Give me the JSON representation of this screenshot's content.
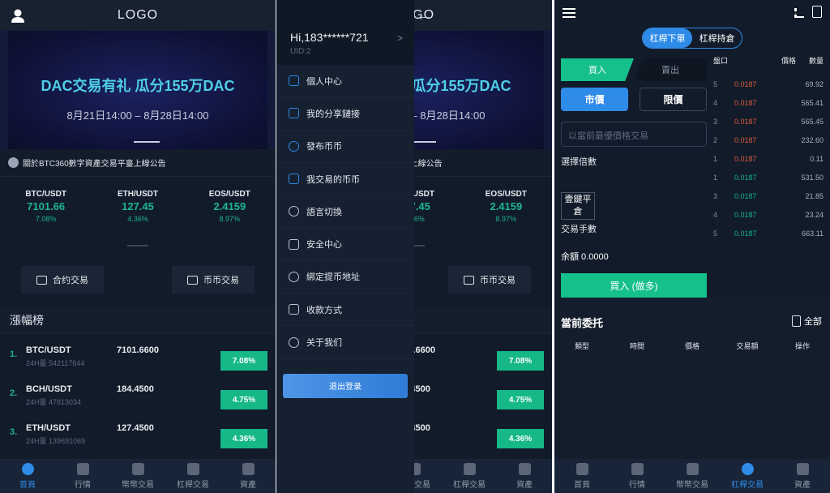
{
  "home": {
    "logo": "LOGO",
    "banner_title": "DAC交易有礼 瓜分155万DAC",
    "banner_date": "8月21日14:00 – 8月28日14:00",
    "notice": "關於BTC360數字資產交易平臺上線公告",
    "tickers": [
      {
        "pair": "BTC/USDT",
        "price": "7101.66",
        "change": "7.08%"
      },
      {
        "pair": "ETH/USDT",
        "price": "127.45",
        "change": "4.36%"
      },
      {
        "pair": "EOS/USDT",
        "price": "2.4159",
        "change": "8.97%"
      }
    ],
    "buttons": {
      "contract": "合约交易",
      "coin": "币币交易"
    },
    "ranking_title": "漲幅榜",
    "ranking": [
      {
        "rank": "1.",
        "pair": "BTC/USDT",
        "volume": "24H量 542117644",
        "price": "7101.6600",
        "change": "7.08%"
      },
      {
        "rank": "2.",
        "pair": "BCH/USDT",
        "volume": "24H量 47813034",
        "price": "184.4500",
        "change": "4.75%"
      },
      {
        "rank": "3.",
        "pair": "ETH/USDT",
        "volume": "24H量 139691069",
        "price": "127.4500",
        "change": "4.36%"
      }
    ]
  },
  "nav": [
    "首頁",
    "行情",
    "幣幣交易",
    "杠桿交易",
    "資產"
  ],
  "drawer": {
    "greeting": "Hi,183******721",
    "uid": "UID:2",
    "items": [
      "個人中心",
      "我的分享鏈接",
      "發布币币",
      "我交易的币币",
      "語言切換",
      "安全中心",
      "綁定提币地址",
      "收款方式",
      "关于我们"
    ],
    "logout": "退出登录"
  },
  "trade": {
    "tabs": [
      "杠桿下單",
      "杠桿持倉"
    ],
    "buy": "買入",
    "sell": "賣出",
    "market": "市價",
    "limit": "限價",
    "input_placeholder": "以當前最優價格交易",
    "multiplier": "選擇倍數",
    "one_key_close": "壹鍵平倉",
    "lots": "交易手數",
    "balance": "余額 0.0000",
    "buy_long": "買入 (做多)",
    "book_headers": [
      "盤口",
      "價格",
      "數量"
    ],
    "asks": [
      [
        "5",
        "0.0187",
        "69.92"
      ],
      [
        "4",
        "0.0187",
        "565.41"
      ],
      [
        "3",
        "0.0187",
        "565.45"
      ],
      [
        "2",
        "0.0187",
        "232.60"
      ],
      [
        "1",
        "0.0187",
        "0.11"
      ]
    ],
    "bids": [
      [
        "1",
        "0.0187",
        "531.50"
      ],
      [
        "3",
        "0.0187",
        "21.85"
      ],
      [
        "4",
        "0.0187",
        "23.24"
      ],
      [
        "5",
        "0.0187",
        "663.11"
      ]
    ],
    "orders_title": "當前委托",
    "all": "全部",
    "order_cols": [
      "類型",
      "時間",
      "價格",
      "交易額",
      "操作"
    ]
  }
}
